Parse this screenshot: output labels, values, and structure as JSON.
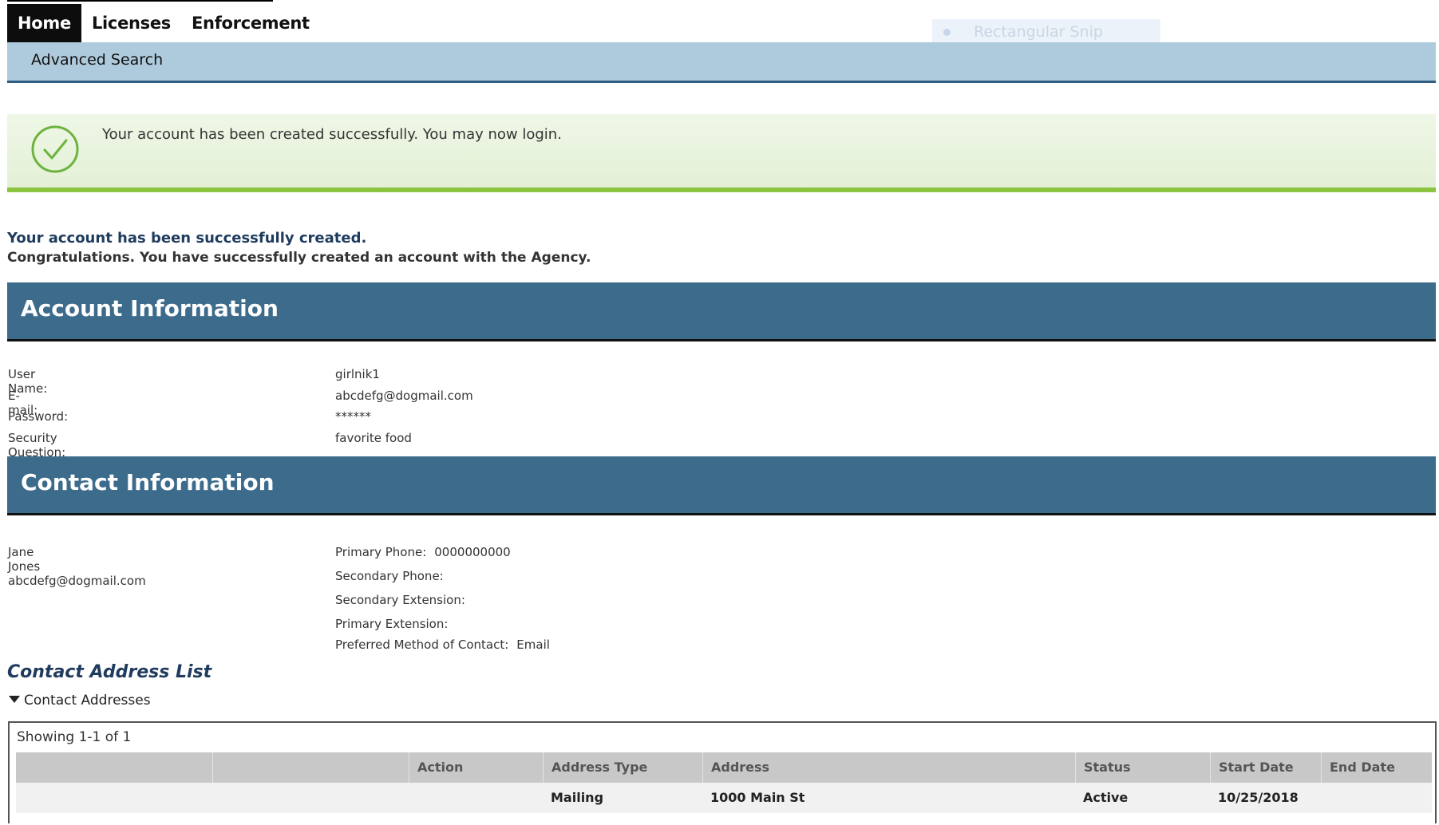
{
  "nav": {
    "tabs": [
      {
        "label": "Home"
      },
      {
        "label": "Licenses"
      },
      {
        "label": "Enforcement"
      }
    ],
    "subnav": {
      "label": "Advanced Search"
    }
  },
  "overlay": {
    "label": "Rectangular Snip"
  },
  "banner": {
    "message": "Your account has been created successfully. You may now login.",
    "icon": "check-circle-icon",
    "color": "#8cc43f"
  },
  "confirmation": {
    "title": "Your account has been successfully created.",
    "subtitle": "Congratulations. You have successfully created an account with the Agency."
  },
  "account": {
    "section_title": "Account Information",
    "fields": [
      {
        "label": "User Name:",
        "value": "girlnik1"
      },
      {
        "label": "E-mail:",
        "value": "abcdefg@dogmail.com"
      },
      {
        "label": "Password:",
        "value": "******"
      },
      {
        "label": "Security Question:",
        "value": "favorite food"
      }
    ]
  },
  "contact": {
    "section_title": "Contact Information",
    "name": "Jane Jones",
    "email": "abcdefg@dogmail.com",
    "details": [
      {
        "label": "Primary Phone:",
        "value": "0000000000"
      },
      {
        "label": "Secondary Phone:",
        "value": ""
      },
      {
        "label": "Secondary Extension:",
        "value": ""
      },
      {
        "label": "Primary Extension:",
        "value": ""
      },
      {
        "label": "Preferred Method of Contact:",
        "value": "Email"
      }
    ]
  },
  "addresses": {
    "title": "Contact Address List",
    "toggle_label": "Contact Addresses",
    "showing": "Showing 1-1 of 1",
    "columns": [
      "",
      "",
      "Action",
      "Address Type",
      "Address",
      "Status",
      "Start Date",
      "End Date"
    ],
    "rows": [
      [
        "",
        "",
        "",
        "Mailing",
        "1000 Main St",
        "Active",
        "10/25/2018",
        ""
      ]
    ]
  },
  "colors": {
    "section_bar": "#3d6b8c",
    "subnav": "#aecbdd",
    "heading_text": "#1f3b5e"
  }
}
